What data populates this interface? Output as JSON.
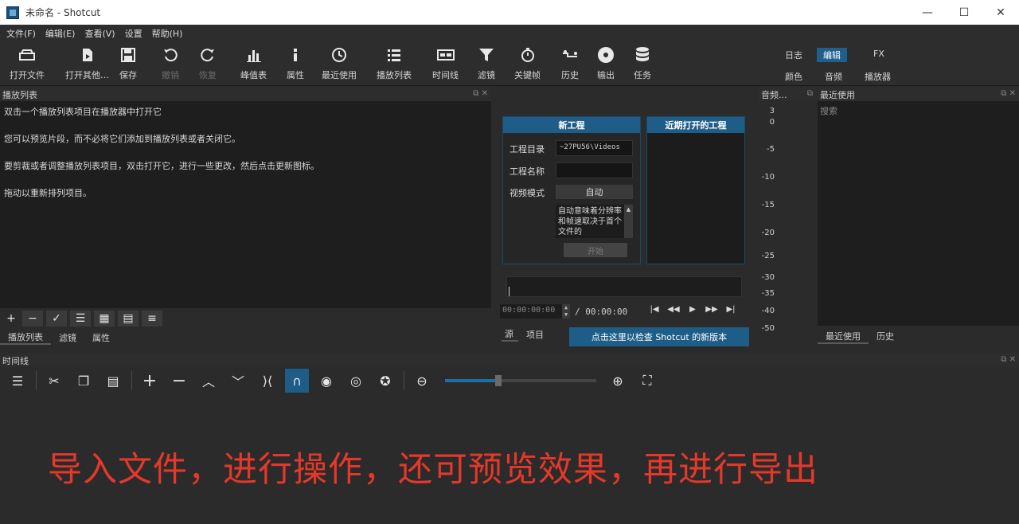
{
  "window": {
    "title": "未命名 - Shotcut",
    "minimize": "—",
    "maximize": "☐",
    "close": "✕"
  },
  "menubar": [
    "文件(F)",
    "编辑(E)",
    "查看(V)",
    "设置",
    "帮助(H)"
  ],
  "toolbar": {
    "items": [
      {
        "label": "打开文件",
        "icon": "open-folder-icon"
      },
      {
        "label": "打开其他…",
        "icon": "open-other-icon"
      },
      {
        "label": "保存",
        "icon": "save-icon"
      },
      {
        "label": "撤销",
        "icon": "undo-icon",
        "disabled": true
      },
      {
        "label": "恢复",
        "icon": "redo-icon",
        "disabled": true
      },
      {
        "label": "峰值表",
        "icon": "peak-meter-icon"
      },
      {
        "label": "属性",
        "icon": "info-icon"
      },
      {
        "label": "最近使用",
        "icon": "clock-icon"
      },
      {
        "label": "播放列表",
        "icon": "list-icon"
      },
      {
        "label": "时间线",
        "icon": "timeline-icon"
      },
      {
        "label": "滤镜",
        "icon": "filter-funnel-icon"
      },
      {
        "label": "关键帧",
        "icon": "stopwatch-icon"
      },
      {
        "label": "历史",
        "icon": "history-icon"
      },
      {
        "label": "输出",
        "icon": "disc-export-icon"
      },
      {
        "label": "任务",
        "icon": "jobs-database-icon"
      }
    ],
    "layouts_top": [
      "日志",
      "编辑",
      "FX"
    ],
    "layouts_bottom": [
      "颜色",
      "音频",
      "播放器"
    ],
    "active_layout": "编辑"
  },
  "playlist": {
    "title": "播放列表",
    "lines": [
      "双击一个播放列表项目在播放器中打开它",
      "您可以预览片段，而不必将它们添加到播放列表或者关闭它。",
      "要剪裁或者调整播放列表项目，双击打开它，进行一些更改，然后点击更新图标。",
      "拖动以重新排列项目。"
    ],
    "buttons": [
      "+",
      "−",
      "✓",
      "☰",
      "▦",
      "▤",
      "≡"
    ],
    "tabs": [
      "播放列表",
      "滤镜",
      "属性"
    ]
  },
  "new_project": {
    "title": "新工程",
    "dir_label": "工程目录",
    "dir_value": "~27PU56\\Videos",
    "name_label": "工程名称",
    "name_value": "",
    "mode_label": "视频模式",
    "mode_value": "自动",
    "mode_desc": "自动意味着分辨率和帧速取决于首个文件的",
    "start_button": "开始"
  },
  "recent_projects": {
    "title": "近期打开的工程"
  },
  "player": {
    "position": "00:00:00:00",
    "duration": "/ 00:00:00",
    "tabs": [
      "源",
      "项目"
    ],
    "update_link": "点击这里以检查 Shotcut 的新版本"
  },
  "audio_meter": {
    "title": "音频...",
    "scale": [
      "3",
      "0",
      "-5",
      "-10",
      "-15",
      "-20",
      "-25",
      "-30",
      "-35",
      "-40",
      "-50"
    ]
  },
  "recent": {
    "title": "最近使用",
    "search_placeholder": "搜索",
    "tabs": [
      "最近使用",
      "历史"
    ]
  },
  "timeline": {
    "title": "时间线",
    "zoom_level": 0.35
  },
  "caption": "导入文件，进行操作，还可预览效果，再进行导出",
  "colors": {
    "accent": "#1e5d87",
    "caption": "#e5382a"
  }
}
